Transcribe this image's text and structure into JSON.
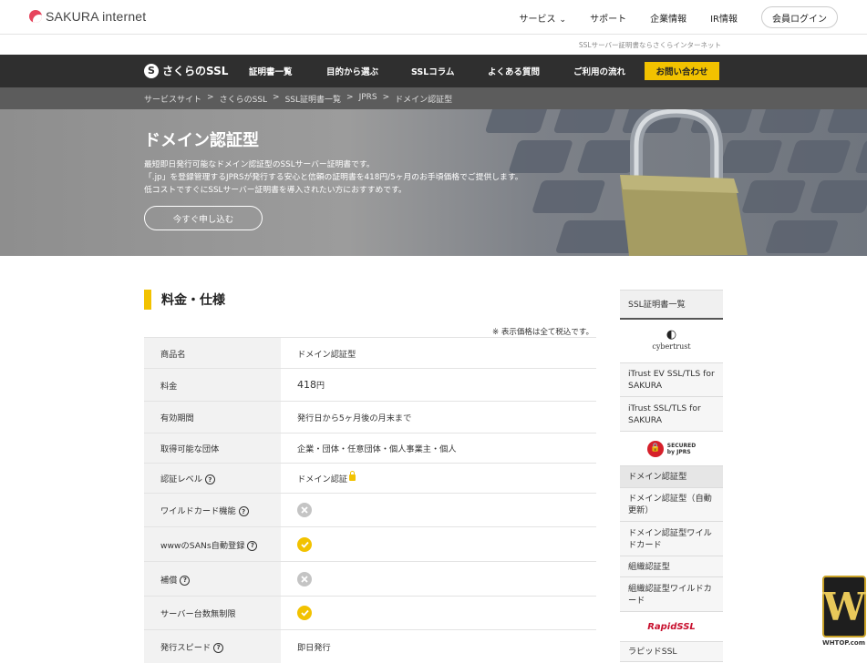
{
  "header": {
    "logo_text": "SAKURA internet",
    "nav": [
      {
        "label": "サービス",
        "has_dropdown": true
      },
      {
        "label": "サポート"
      },
      {
        "label": "企業情報"
      },
      {
        "label": "IR情報"
      }
    ],
    "login_label": "会員ログイン",
    "tagline": "SSLサーバー証明書ならさくらインターネット"
  },
  "mainnav": {
    "brand": "さくらのSSL",
    "items": [
      "証明書一覧",
      "目的から選ぶ",
      "SSLコラム",
      "よくある質問",
      "ご利用の流れ"
    ],
    "contact_label": "お問い合わせ"
  },
  "breadcrumb": [
    "サービスサイト",
    "さくらのSSL",
    "SSL証明書一覧",
    "JPRS",
    "ドメイン認証型"
  ],
  "breadcrumb_sep": ">",
  "hero": {
    "title": "ドメイン認証型",
    "lines": [
      "最短即日発行可能なドメイン認証型のSSLサーバー証明書です。",
      "「.jp」を登録管理するJPRSが発行する安心と信頼の証明書を418円/5ヶ月のお手頃価格でご提供します。",
      "低コストですぐにSSLサーバー証明書を導入されたい方におすすめです。"
    ],
    "apply_label": "今すぐ申し込む"
  },
  "section": {
    "title": "料金・仕様",
    "tax_note": "※ 表示価格は全て税込です。"
  },
  "spec_rows": [
    {
      "key": "商品名",
      "value": "ドメイン認証型"
    },
    {
      "key": "料金",
      "value_num": "418",
      "value_unit": "円"
    },
    {
      "key": "有効期間",
      "value": "発行日から5ヶ月後の月末まで"
    },
    {
      "key": "取得可能な団体",
      "value": "企業・団体・任意団体・個人事業主・個人"
    },
    {
      "key": "認証レベル",
      "value": "ドメイン認証",
      "help": "?"
    },
    {
      "key": "ワイルドカード機能",
      "status": "no",
      "help": "?"
    },
    {
      "key": "wwwのSANs自動登録",
      "status": "yes",
      "help": "?"
    },
    {
      "key": "補償",
      "status": "no",
      "help": "?"
    },
    {
      "key": "サーバー台数無制限",
      "status": "yes"
    },
    {
      "key": "発行スピード",
      "value": "即日発行",
      "help": "?"
    }
  ],
  "sidebar": {
    "heading": "SSL証明書一覧",
    "cybertrust_logo": "cybertrust",
    "cybertrust_items": [
      "iTrust EV SSL/TLS for SAKURA",
      "iTrust SSL/TLS for SAKURA"
    ],
    "jprs_logo_top": "SECURED",
    "jprs_logo_bottom": "by JPRS",
    "jprs_items": [
      "ドメイン認証型",
      "ドメイン認証型（自動更新）",
      "ドメイン認証型ワイルドカード",
      "組織認証型",
      "組織認証型ワイルドカード"
    ],
    "rapidssl_logo": "RapidSSL",
    "rapidssl_items": [
      "ラピッドSSL"
    ]
  },
  "watermark": {
    "top": "W",
    "bottom": "WHTOP.com"
  },
  "colors": {
    "accent": "#f2c200",
    "nav_bg": "#2f2f2f",
    "crumb_bg": "#5c5c5c",
    "brand_red": "#e6455d"
  }
}
